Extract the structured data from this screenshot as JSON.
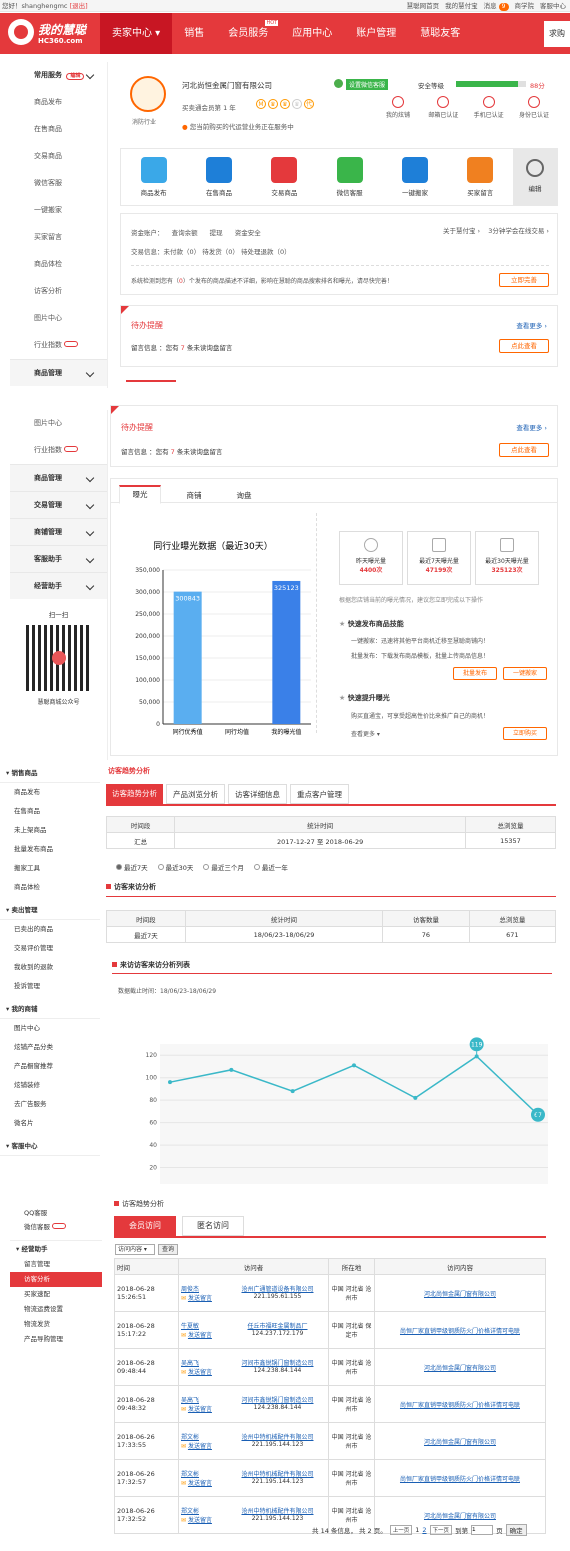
{
  "topbar": {
    "greeting": "您好！shanghengmc",
    "logout": "[退出]",
    "links": [
      "慧聪网首页",
      "我的慧付宝",
      "消息",
      "商学院",
      "客服中心"
    ],
    "msg_count": "9"
  },
  "header": {
    "logo_text": "我的慧聪",
    "logo_sub": "HC360.com",
    "nav": [
      "卖家中心",
      "销售",
      "会员服务",
      "应用中心",
      "账户管理",
      "慧聪友客"
    ],
    "hot": "HOT",
    "search": "求购"
  },
  "sidebar1": {
    "title": "常用服务",
    "edit": "编辑",
    "items": [
      "商品发布",
      "在售商品",
      "交易商品",
      "微信客服",
      "一键搬家",
      "买家留言",
      "商品体检",
      "访客分析",
      "图片中心",
      "行业指数"
    ],
    "goods_mgmt": "商品管理"
  },
  "profile": {
    "company": "河北尚恒金属门窗有限公司",
    "sub": "买卖通会员第 1 年",
    "role": "消防行业",
    "wechat": "设置微信客服",
    "security_label": "安全等级",
    "score": "88分",
    "notice": "您当前购买的代运营业务正在服务中",
    "badges": [
      "M",
      "♛",
      "♛",
      "♛",
      "代"
    ],
    "verify": [
      "我的炫铺",
      "邮箱已认证",
      "手机已认证",
      "身份已认证"
    ]
  },
  "quick": {
    "items": [
      "商品发布",
      "在售商品",
      "交易商品",
      "微信客服",
      "一键搬家",
      "买家留言"
    ],
    "edit": "编辑"
  },
  "account": {
    "balance_label": "资金账户：",
    "query": "查询余额",
    "withdraw": "提现",
    "security": "资金安全",
    "huifu": "关于慧付宝",
    "learn": "3分钟学会在线交易",
    "trade_label": "交易信息：",
    "unpaid": "未付款（0）",
    "unshipped": "待发货（0）",
    "refund": "待处理退款（0）",
    "warn_pre": "系统检测到您有（",
    "warn_num": "0",
    "warn_post": "）个发布的商品描述不详细，影响在慧聪的商品搜索排名和曝光，请尽快完善！",
    "improve": "立即完善"
  },
  "todo": {
    "title": "待办提醒",
    "more": "查看更多 ›",
    "text_pre": "留言信息 ：您有",
    "count": "7",
    "text_post": "条未读询盘留言",
    "btn": "点此查看"
  },
  "sidebar2": {
    "items": [
      "图片中心",
      "行业指数"
    ],
    "groups": [
      "商品管理",
      "交易管理",
      "商铺管理",
      "客服助手",
      "经营助手"
    ],
    "qr_title": "扫一扫",
    "qr_caption": "慧聪商城公众号"
  },
  "tabs": [
    "曝光",
    "商铺",
    "询盘"
  ],
  "chart_data": {
    "type": "bar",
    "title": "同行业曝光数据（最近30天）",
    "categories": [
      "同行优秀值",
      "同行均值",
      "我的曝光值"
    ],
    "values": [
      300843,
      0,
      325123
    ],
    "yticks": [
      "350,000",
      "300,000",
      "250,000",
      "200,000",
      "150,000",
      "100,000",
      "50,000",
      "0"
    ],
    "ylim": [
      0,
      350000
    ],
    "labels": [
      "300843",
      "",
      "325123"
    ]
  },
  "stats": {
    "items": [
      {
        "label": "昨天曝光量",
        "value": "4400次"
      },
      {
        "label": "最近7天曝光量",
        "value": "47199次"
      },
      {
        "label": "最近30天曝光量",
        "value": "325123次"
      }
    ],
    "note": "根据您店铺当前的曝光情况，建议您立即完成以下操作"
  },
  "tips": {
    "t1": "快速发布商品技能",
    "l1": "一键搬家：迅速将其他平台商机迁移至慧聪商铺内！",
    "l2": "批量发布：下载发布商品模板，批量上传商品信息！",
    "b1": "批量发布",
    "b2": "一键搬家",
    "t2": "快速提升曝光",
    "l3": "购买直通宝，可享受超高性价比来推广自己的商机！",
    "more": "查看更多",
    "b3": "立即购买"
  },
  "sidebar3": {
    "sections": [
      {
        "title": "销售商品",
        "items": [
          "商品发布",
          "在售商品",
          "未上架商品",
          "批量发布商品",
          "搬家工具",
          "商品体检"
        ]
      },
      {
        "title": "卖出管理",
        "items": [
          "已卖出的商品",
          "交易评价管理",
          "我收到的退款",
          "投诉管理"
        ]
      },
      {
        "title": "我的商铺",
        "items": [
          "图片中心",
          "炫铺产品分类",
          "产品橱窗推荐",
          "炫铺装修",
          "去广告服务",
          "微名片"
        ]
      },
      {
        "title": "客服中心",
        "items": []
      }
    ]
  },
  "visitor": {
    "title": "访客趋势分析",
    "tabs": [
      "访客趋势分析",
      "产品浏览分析",
      "访客详细信息",
      "重点客户管理"
    ],
    "headers": [
      "时间段",
      "统计时间",
      "总浏览量"
    ],
    "row": [
      "汇总",
      "2017-12-27 至 2018-06-29",
      "15357"
    ],
    "radios": [
      "最近7天",
      "最近30天",
      "最近三个月",
      "最近一年"
    ],
    "src_title": "访客来访分析",
    "src_headers": [
      "时间段",
      "统计时间",
      "访客数量",
      "总浏览量"
    ],
    "src_row": [
      "最近7天",
      "18/06/23-18/06/29",
      "76",
      "671"
    ],
    "list_title": "来访访客来访分析列表",
    "deadline": "数据截止时间：18/06/23-18/06/29"
  },
  "line_chart": {
    "type": "line",
    "x": [
      "2018-06-23",
      "2018-06-24",
      "2018-06-25",
      "2018-06-26",
      "2018-06-27",
      "2018-06-28",
      "2018-06-29"
    ],
    "values": [
      96,
      107,
      88,
      111,
      82,
      119,
      67
    ],
    "yticks": [
      "120",
      "100",
      "80",
      "60",
      "40",
      "20"
    ],
    "ylim": [
      0,
      130
    ],
    "labels": [
      "",
      "",
      "",
      "",
      "",
      "119",
      "67"
    ]
  },
  "sidebar4": {
    "items": [
      "QQ客服",
      "微信客服"
    ],
    "group": "经营助手",
    "items2": [
      "留言管理",
      "访客分析",
      "买家速配",
      "物流运费设置",
      "物流发货",
      "产品导购管理"
    ]
  },
  "member": {
    "title": "访客趋势分析",
    "tabs": [
      "会员访问",
      "匿名访问"
    ],
    "filter": "访问内容",
    "query": "查询",
    "headers": [
      "时间",
      "访问者",
      "所在地",
      "访问内容"
    ],
    "rows": [
      {
        "time": "2018-06-28 15:26:51",
        "name": "周俊杰",
        "send": "发送留言",
        "company": "沧州广通管道设备有限公司",
        "ip": "221.195.61.155",
        "loc": "中国 河北省 沧州市",
        "content": "河北尚恒金属门窗有限公司"
      },
      {
        "time": "2018-06-28 15:17:22",
        "name": "牛夏敏",
        "send": "发送留言",
        "company": "任丘市福旺金属制品厂",
        "ip": "124.237.172.179",
        "loc": "中国 河北省 保定市",
        "content": "尚恒厂家直销甲级钢质防火门价格详情可电联"
      },
      {
        "time": "2018-06-28 09:48:44",
        "name": "吴高飞",
        "send": "发送留言",
        "company": "河间市鑫锐锅门窗制造公司",
        "ip": "124.238.84.144",
        "loc": "中国 河北省 沧州市",
        "content": "河北尚恒金属门窗有限公司"
      },
      {
        "time": "2018-06-28 09:48:32",
        "name": "吴高飞",
        "send": "发送留言",
        "company": "河间市鑫锐锅门窗制造公司",
        "ip": "124.238.84.144",
        "loc": "中国 河北省 沧州市",
        "content": "尚恒厂家直销甲级钢质防火门价格详情可电联"
      },
      {
        "time": "2018-06-26 17:33:55",
        "name": "郑文彬",
        "send": "发送留言",
        "company": "沧州中特机械配件有限公司",
        "ip": "221.195.144.123",
        "loc": "中国 河北省 沧州市",
        "content": "河北尚恒金属门窗有限公司"
      },
      {
        "time": "2018-06-26 17:32:57",
        "name": "郑文彬",
        "send": "发送留言",
        "company": "沧州中特机械配件有限公司",
        "ip": "221.195.144.123",
        "loc": "中国 河北省 沧州市",
        "content": "尚恒厂家直销甲级钢质防火门价格详情可电联"
      },
      {
        "time": "2018-06-26 17:32:52",
        "name": "郑文彬",
        "send": "发送留言",
        "company": "沧州中特机械配件有限公司",
        "ip": "221.195.144.123",
        "loc": "中国 河北省 沧州市",
        "content": "河北尚恒金属门窗有限公司"
      }
    ],
    "pager": {
      "total": "共 14 条信息， 共 2 页。",
      "prev": "上一页",
      "pages": [
        "1",
        "2"
      ],
      "next": "下一页",
      "goto": "到第",
      "page_unit": "页",
      "confirm": "确定",
      "goto_val": "1"
    }
  }
}
